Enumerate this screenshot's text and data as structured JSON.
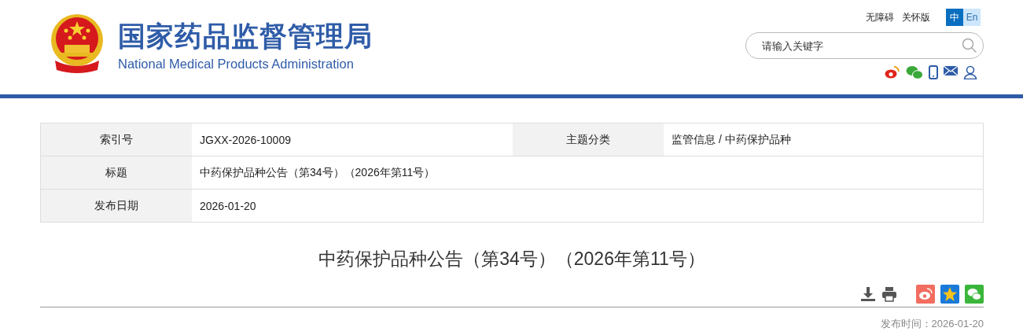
{
  "header": {
    "title_cn": "国家药品监督管理局",
    "title_en": "National Medical Products Administration",
    "links": [
      "无障碍",
      "关怀版"
    ],
    "languages": [
      {
        "label": "中",
        "selected": true
      },
      {
        "label": "En",
        "selected": false
      }
    ],
    "search": {
      "placeholder": "请输入关键字"
    }
  },
  "meta": {
    "rows": [
      [
        {
          "label": "索引号",
          "value": "JGXX-2026-10009"
        },
        {
          "label": "主题分类",
          "value": "监管信息 / 中药保护品种"
        }
      ],
      [
        {
          "label": "标题",
          "value": "中药保护品种公告（第34号）（2026年第11号）"
        }
      ],
      [
        {
          "label": "发布日期",
          "value": "2026-01-20"
        }
      ]
    ]
  },
  "article": {
    "title": "中药保护品种公告（第34号）（2026年第11号）",
    "publish_time": "发布时间：2026-01-20"
  }
}
